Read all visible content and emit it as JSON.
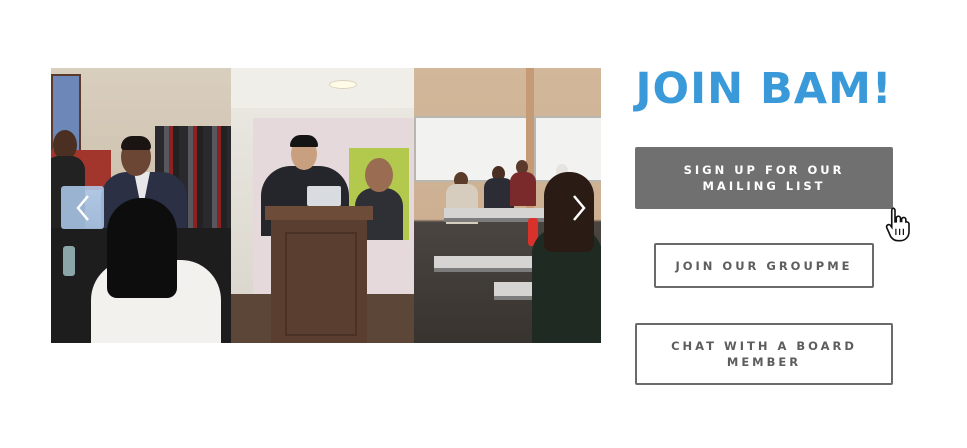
{
  "slider": {
    "slides": [
      {
        "name": "networking-photo"
      },
      {
        "name": "podium-speaker-photo"
      },
      {
        "name": "classroom-photo"
      }
    ],
    "prev_icon": "chevron-left-icon",
    "next_icon": "chevron-right-icon",
    "accent_prev_bg": "#afcdf0"
  },
  "join": {
    "title": "JOIN BAM!",
    "title_color": "#3a9ad9",
    "buttons": {
      "mailing_list": "SIGN UP FOR OUR MAILING LIST",
      "groupme": "JOIN OUR GROUPME",
      "board_member": "CHAT WITH A BOARD MEMBER"
    },
    "primary_button_color": "#707070"
  },
  "cursor": {
    "icon": "hand-pointer-icon"
  }
}
